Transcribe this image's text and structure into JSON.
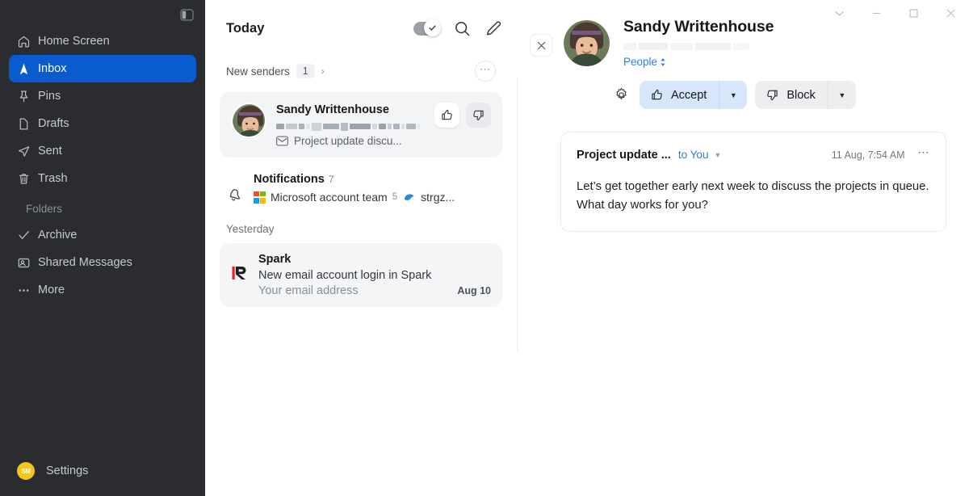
{
  "sidebar": {
    "panel_toggle_icon": "panel-toggle-icon",
    "items": [
      {
        "label": "Home Screen",
        "icon": "home-icon",
        "active": false
      },
      {
        "label": "Inbox",
        "icon": "inbox-paperplane-icon",
        "active": true
      },
      {
        "label": "Pins",
        "icon": "pin-icon",
        "active": false
      },
      {
        "label": "Drafts",
        "icon": "document-icon",
        "active": false
      },
      {
        "label": "Sent",
        "icon": "send-icon",
        "active": false
      },
      {
        "label": "Trash",
        "icon": "trash-icon",
        "active": false
      }
    ],
    "folders_label": "Folders",
    "folders": [
      {
        "label": "Archive",
        "icon": "check-icon"
      },
      {
        "label": "Shared Messages",
        "icon": "shared-inbox-icon"
      },
      {
        "label": "More",
        "icon": "ellipsis-icon"
      }
    ],
    "settings": {
      "label": "Settings",
      "avatar_initials": "SM",
      "avatar_color": "#f5c518"
    },
    "active_color": "#0a5ad0",
    "background": "#2a2c30"
  },
  "list": {
    "title": "Today",
    "toggle_icon": "checkmark-toggle",
    "search_icon": "search-icon",
    "compose_icon": "compose-pencil-icon",
    "new_senders": {
      "label": "New senders",
      "count": "1",
      "chevron": "chevron-right-icon",
      "more_icon": "ellipsis-icon"
    },
    "message_card": {
      "sender": "Sandy Writtenhouse",
      "email_redacted": true,
      "subject": "Project update discu...",
      "subject_icon": "envelope-icon",
      "accept_icon": "thumbs-up-icon",
      "reject_icon": "thumbs-down-icon"
    },
    "notifications": {
      "title": "Notifications",
      "count": "7",
      "icon": "bell-icon",
      "senders": [
        {
          "name": "Microsoft account team",
          "count": "5",
          "icon": "microsoft-logo-icon"
        },
        {
          "name": "strgz...",
          "count": "",
          "icon": "blue-blob-icon"
        }
      ]
    },
    "day_label": "Yesterday",
    "spark_card": {
      "icon": "spark-logo-icon",
      "title": "Spark",
      "line": "New email account login in Spark",
      "sub": "Your email address",
      "date": "Aug 10"
    }
  },
  "reading": {
    "window_controls": [
      {
        "name": "chevron-down-icon"
      },
      {
        "name": "minimize-icon"
      },
      {
        "name": "maximize-icon"
      },
      {
        "name": "close-icon"
      }
    ],
    "close_icon": "close-icon",
    "name": "Sandy Writtenhouse",
    "email_redacted": true,
    "category_label": "People",
    "category_icon": "sort-updown-icon",
    "gear_icon": "gear-icon",
    "accept": {
      "label": "Accept",
      "icon": "thumbs-up-icon",
      "caret": "caret-down-icon",
      "color": "#d6e6fb"
    },
    "block": {
      "label": "Block",
      "icon": "thumbs-down-icon",
      "caret": "caret-down-icon",
      "color": "#edeef0"
    },
    "message": {
      "subject": "Project update ...",
      "to": "to You",
      "caret": "chevron-down-icon",
      "date": "11 Aug, 7:54 AM",
      "more_icon": "ellipsis-icon",
      "body": "Let’s get together early next week to discuss the projects in queue. What day works for you?"
    }
  }
}
